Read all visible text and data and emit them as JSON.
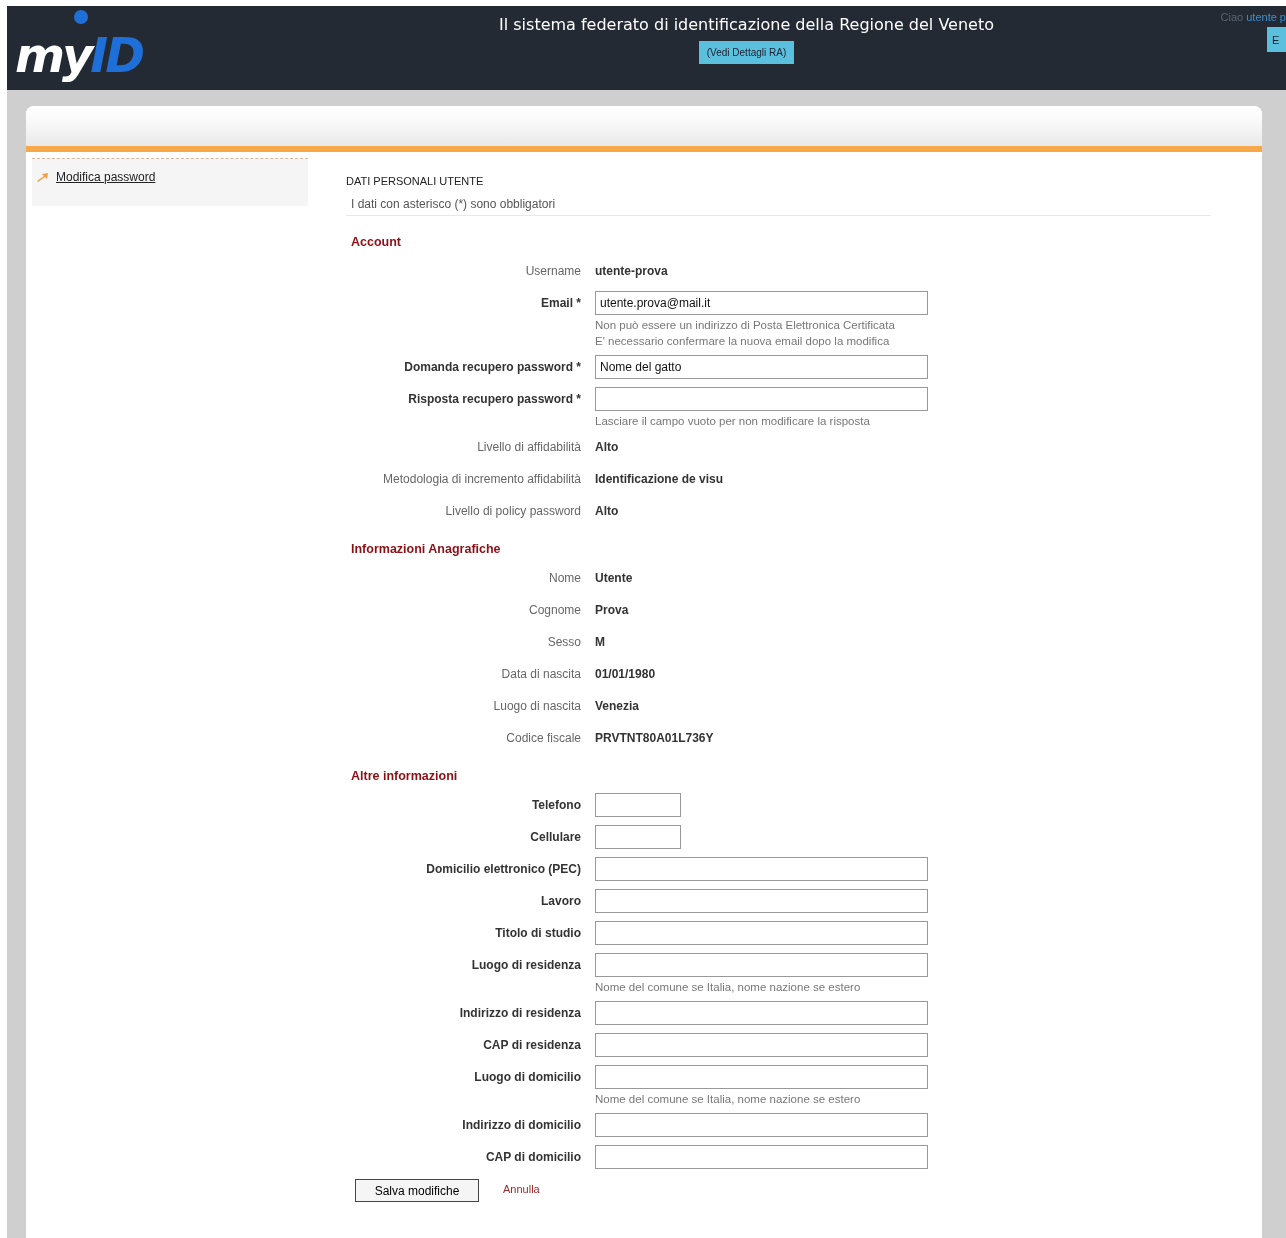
{
  "header": {
    "logo_left": "my",
    "logo_right": "ID",
    "title": "Il sistema federato di identificazione della Regione del Veneto",
    "details_button": "(Vedi Dettagli RA)",
    "greeting": "Ciao",
    "user": "utente p",
    "exit_button": "E"
  },
  "sidebar": {
    "items": [
      {
        "label": "Modifica password"
      }
    ]
  },
  "form": {
    "title": "DATI PERSONALI UTENTE",
    "note": "I dati con asterisco (*) sono obbligatori",
    "sections": [
      {
        "title": "Account",
        "rows": [
          {
            "kind": "text",
            "label": "Username",
            "value": "utente-prova"
          },
          {
            "kind": "input",
            "label": "Email *",
            "value": "utente.prova@mail.it",
            "hints": [
              "Non può essere un indirizzo di Posta Elettronica Certificata",
              "E' necessario confermare la nuova email dopo la modifica"
            ]
          },
          {
            "kind": "input",
            "label": "Domanda recupero password *",
            "value": "Nome del gatto"
          },
          {
            "kind": "input",
            "label": "Risposta recupero password *",
            "hints": [
              "Lasciare il campo vuoto per non modificare la risposta"
            ]
          },
          {
            "kind": "text",
            "label": "Livello di affidabilità",
            "value": "Alto"
          },
          {
            "kind": "text",
            "label": "Metodologia di incremento affidabilità",
            "value": "Identificazione de visu"
          },
          {
            "kind": "text",
            "label": "Livello di policy password",
            "value": "Alto"
          }
        ]
      },
      {
        "title": "Informazioni Anagrafiche",
        "rows": [
          {
            "kind": "text",
            "label": "Nome",
            "value": "Utente"
          },
          {
            "kind": "text",
            "label": "Cognome",
            "value": "Prova"
          },
          {
            "kind": "text",
            "label": "Sesso",
            "value": "M"
          },
          {
            "kind": "text",
            "label": "Data di nascita",
            "value": "01/01/1980"
          },
          {
            "kind": "text",
            "label": "Luogo di nascita",
            "value": "Venezia"
          },
          {
            "kind": "text",
            "label": "Codice fiscale",
            "value": "PRVTNT80A01L736Y"
          }
        ]
      },
      {
        "title": "Altre informazioni",
        "rows": [
          {
            "kind": "short_input",
            "label": "Telefono"
          },
          {
            "kind": "short_input",
            "label": "Cellulare"
          },
          {
            "kind": "input",
            "label": "Domicilio elettronico (PEC)"
          },
          {
            "kind": "input",
            "label": "Lavoro"
          },
          {
            "kind": "input",
            "label": "Titolo di studio"
          },
          {
            "kind": "input",
            "label": "Luogo di residenza",
            "hints": [
              "Nome del comune se Italia, nome nazione se estero"
            ]
          },
          {
            "kind": "input",
            "label": "Indirizzo di residenza"
          },
          {
            "kind": "input",
            "label": "CAP di residenza"
          },
          {
            "kind": "input",
            "label": "Luogo di domicilio",
            "hints": [
              "Nome del comune se Italia, nome nazione se estero"
            ]
          },
          {
            "kind": "input",
            "label": "Indirizzo di domicilio"
          },
          {
            "kind": "input",
            "label": "CAP di domicilio"
          }
        ]
      }
    ],
    "save_button": "Salva modifiche",
    "cancel_link": "Annulla"
  }
}
